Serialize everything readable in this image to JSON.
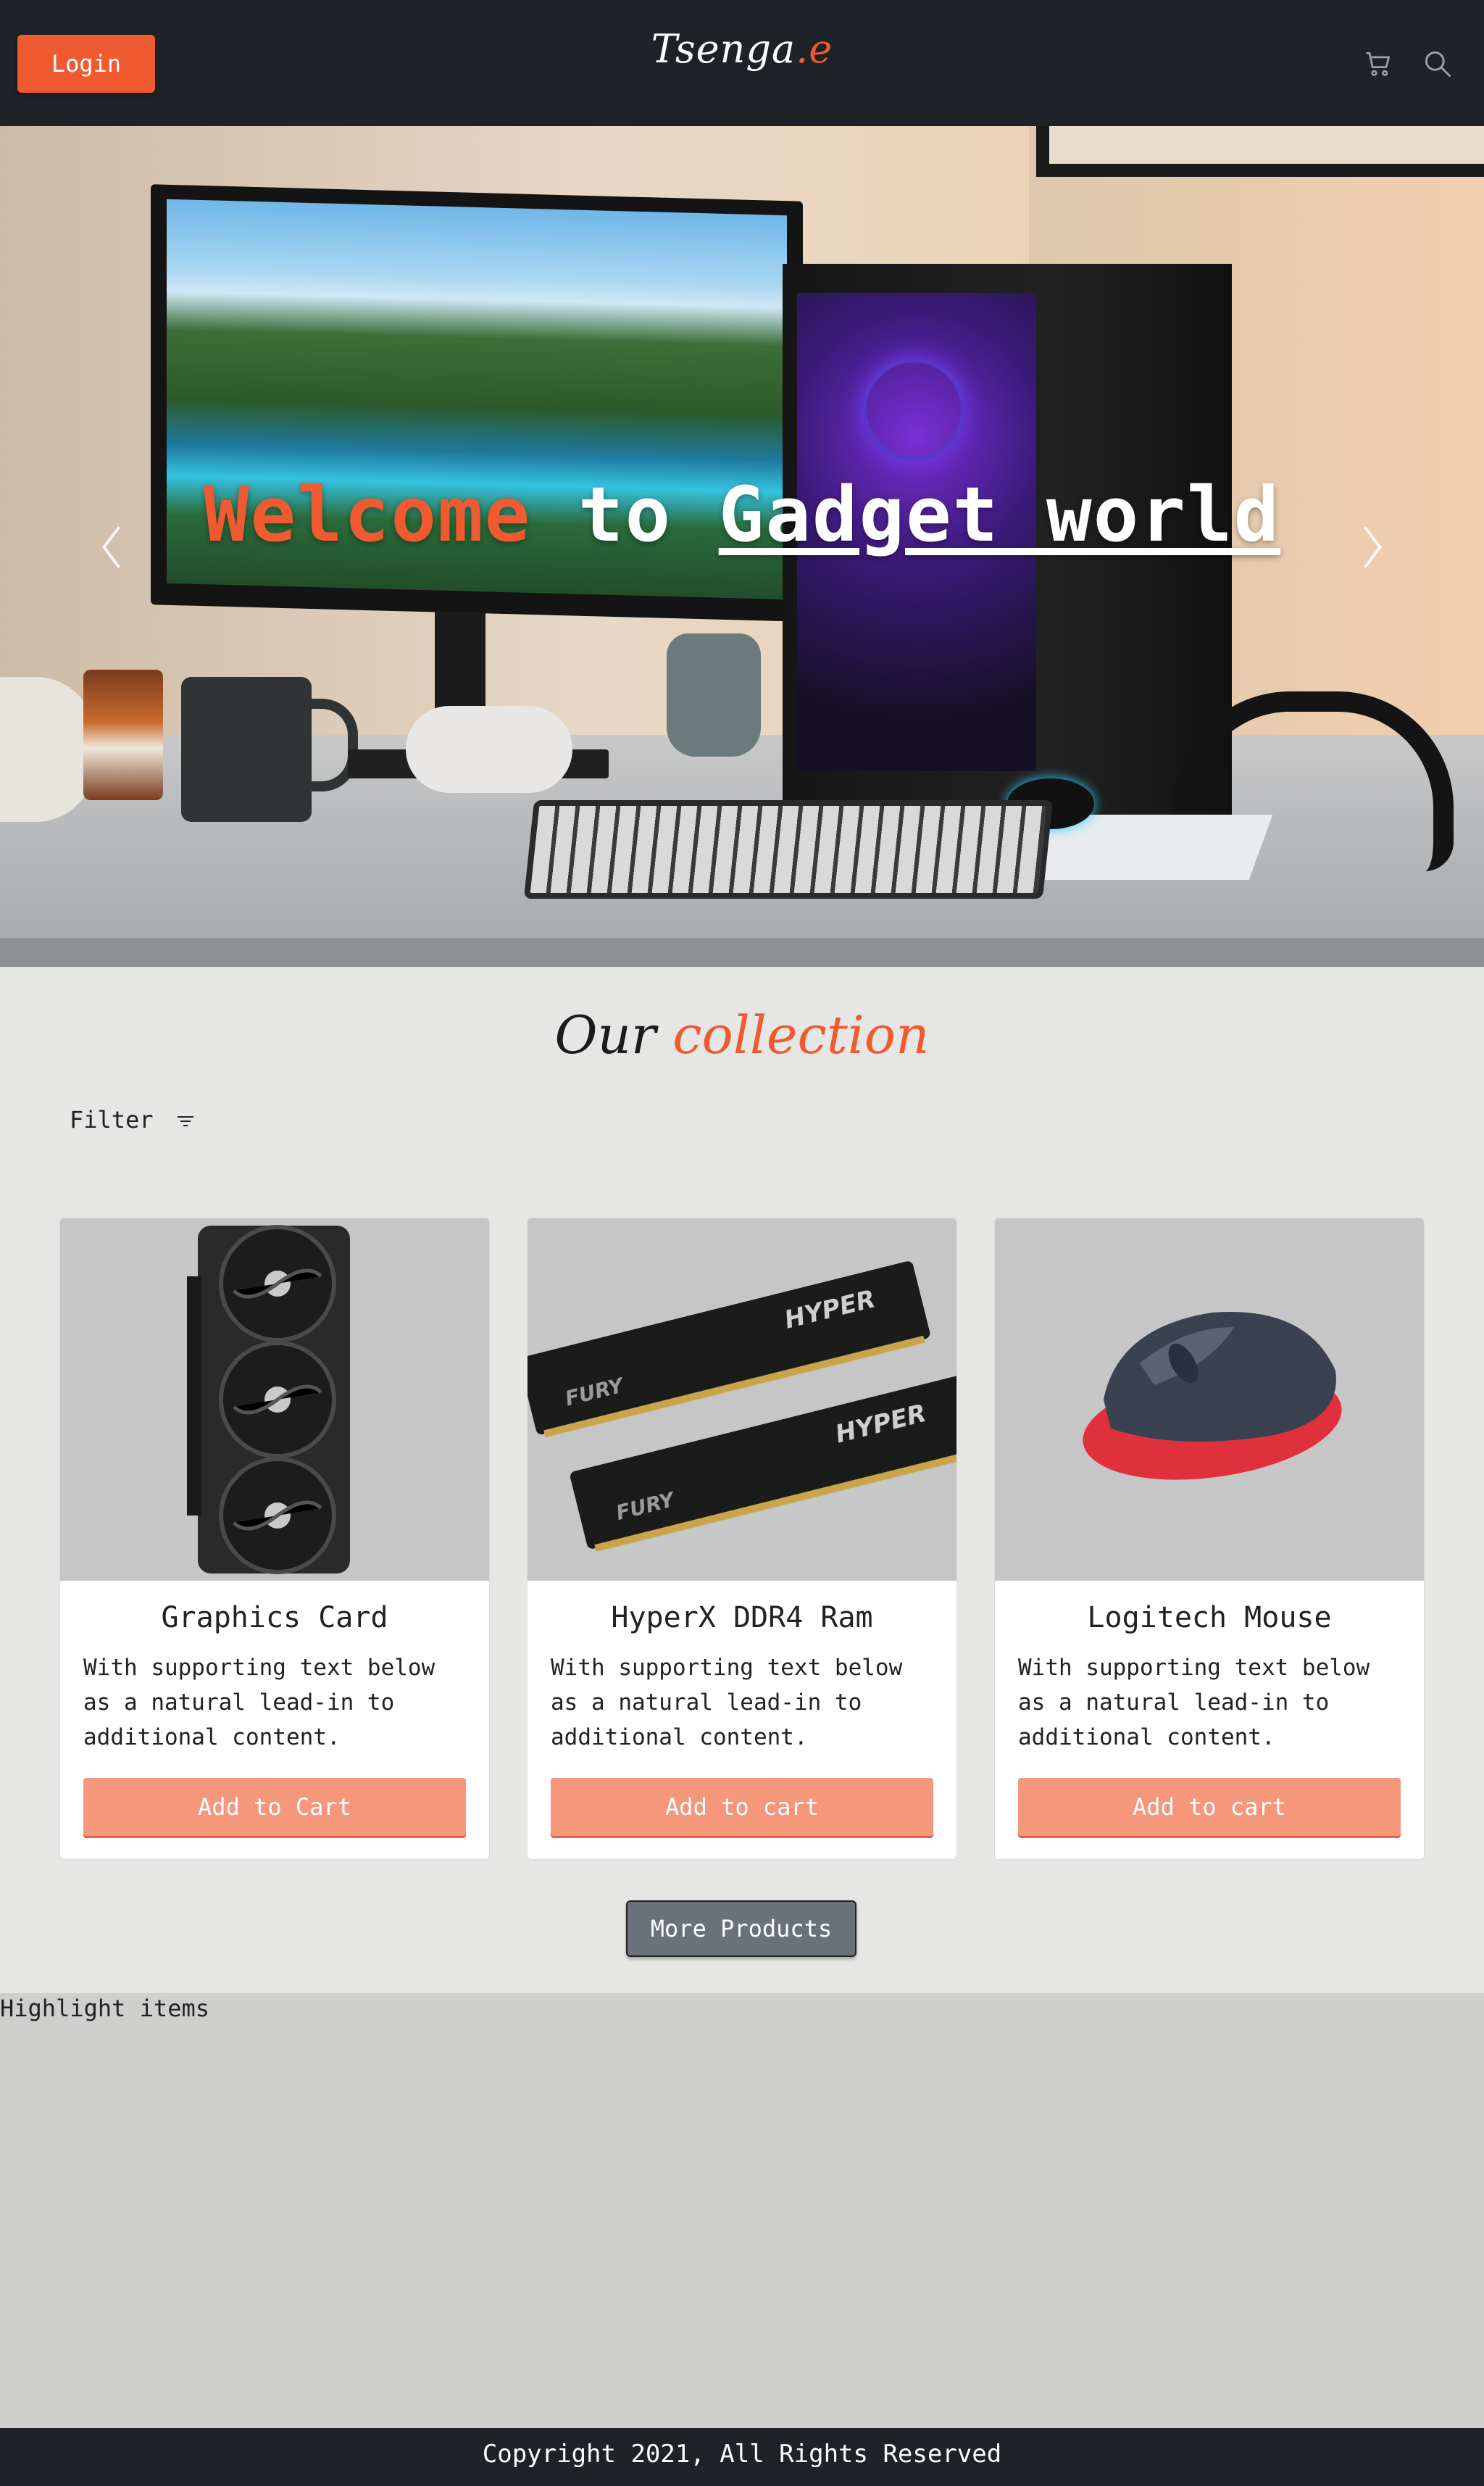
{
  "header": {
    "login_label": "Login",
    "brand_main": "Tsenga",
    "brand_dot": ".e",
    "icons": [
      "cart-icon",
      "search-icon"
    ]
  },
  "hero": {
    "title_word1": "Welcome",
    "title_word2": "to",
    "title_word3": "Gadget world",
    "prev_icon": "chevron-left-icon",
    "next_icon": "chevron-right-icon"
  },
  "collection": {
    "title_part1": "Our",
    "title_part2": "collection",
    "filter_label": "Filter",
    "filter_icon": "filter-lines-icon"
  },
  "products": [
    {
      "title": "Graphics Card",
      "text": "With supporting text below as a natural lead-in to additional content.",
      "button": "Add to Cart"
    },
    {
      "title": "HyperX DDR4 Ram",
      "text": "With supporting text below as a natural lead-in to additional content.",
      "button": "Add to cart"
    },
    {
      "title": "Logitech Mouse",
      "text": "With supporting text below as a natural lead-in to additional content.",
      "button": "Add to cart"
    }
  ],
  "more_products_label": "More Products",
  "highlight": {
    "label": "Highlight items"
  },
  "footer": {
    "copyright": "Copyright 2021, All Rights Reserved"
  },
  "colors": {
    "accent": "#f05a30",
    "navbar": "#1f2226",
    "button_soft": "#f4977a",
    "page_bg": "#e6e7e5",
    "highlight_bg": "#cfd0ce"
  }
}
